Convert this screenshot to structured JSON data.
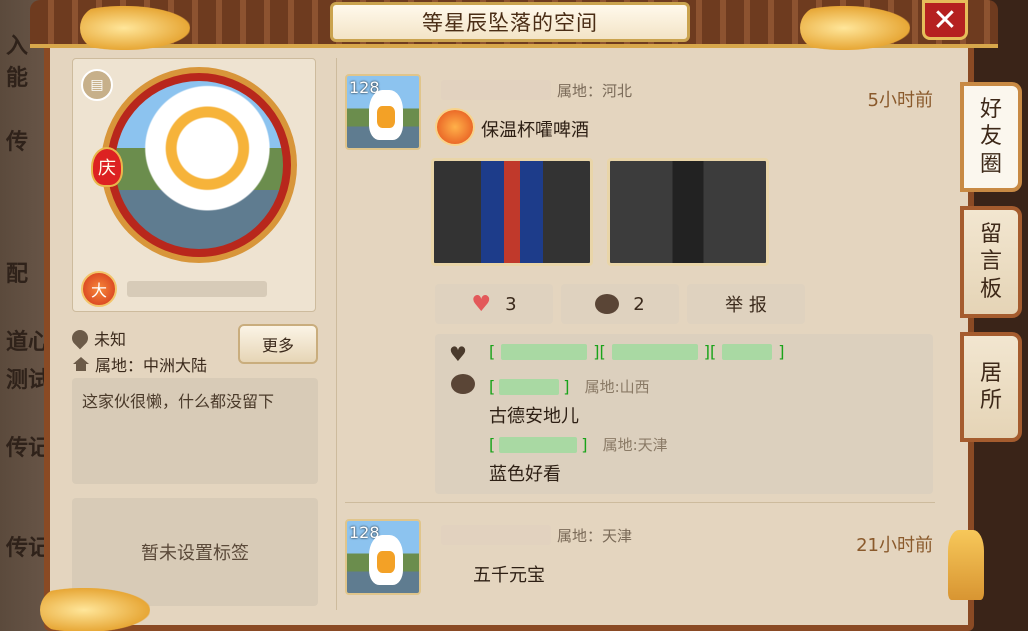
{
  "window": {
    "title": "等星辰坠落的空间"
  },
  "profile": {
    "level_badge": "大",
    "qing_badge": "庆",
    "gender_label": "未知",
    "region_label": "属地：中洲大陆",
    "more_button": "更多",
    "signature": "这家伙很懒，什么都没留下",
    "tags_placeholder": "暂未设置标签"
  },
  "side_tabs": [
    {
      "label": "好友圈",
      "chars": [
        "好",
        "友",
        "圈"
      ],
      "active": true
    },
    {
      "label": "留言板",
      "chars": [
        "留",
        "言",
        "板"
      ],
      "active": false
    },
    {
      "label": "居所",
      "chars": [
        "居",
        "所"
      ],
      "active": false
    }
  ],
  "posts": [
    {
      "avatar_level": "128",
      "location": "属地：河北",
      "time": "5小时前",
      "text": "保温杯嚯啤酒",
      "likes": "3",
      "comments_count": "2",
      "report_label": "举 报",
      "comments": [
        {
          "location": "属地:山西",
          "text": "古德安地儿"
        },
        {
          "location": "属地:天津",
          "text": "蓝色好看"
        }
      ]
    },
    {
      "avatar_level": "128",
      "location": "属地：天津",
      "time": "21小时前",
      "text": "五千元宝"
    }
  ],
  "left_bg_text": [
    "入",
    "能",
    "传",
    "配",
    "道心",
    "测试",
    "传记",
    "传记"
  ],
  "colors": {
    "accent": "#8a4a24",
    "close": "#b52120",
    "like_green": "#1aa31a"
  }
}
